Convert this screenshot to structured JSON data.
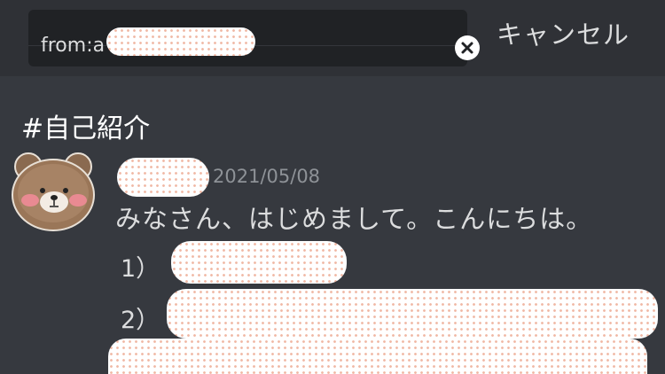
{
  "search": {
    "query": "from:a",
    "clear_icon": "close-icon",
    "cancel_label": "キャンセル"
  },
  "channel": {
    "name": "#自己紹介"
  },
  "message": {
    "timestamp": "2021/05/08",
    "text": "みなさん、はじめまして。こんにちは。",
    "items": [
      {
        "label": "1）"
      },
      {
        "label": "2）"
      }
    ],
    "avatar_icon": "bear-avatar-icon"
  },
  "colors": {
    "background": "#36393f",
    "topbar": "#2f3136",
    "search_box": "#202225",
    "text": "#dcddde",
    "muted": "#8e9297"
  }
}
